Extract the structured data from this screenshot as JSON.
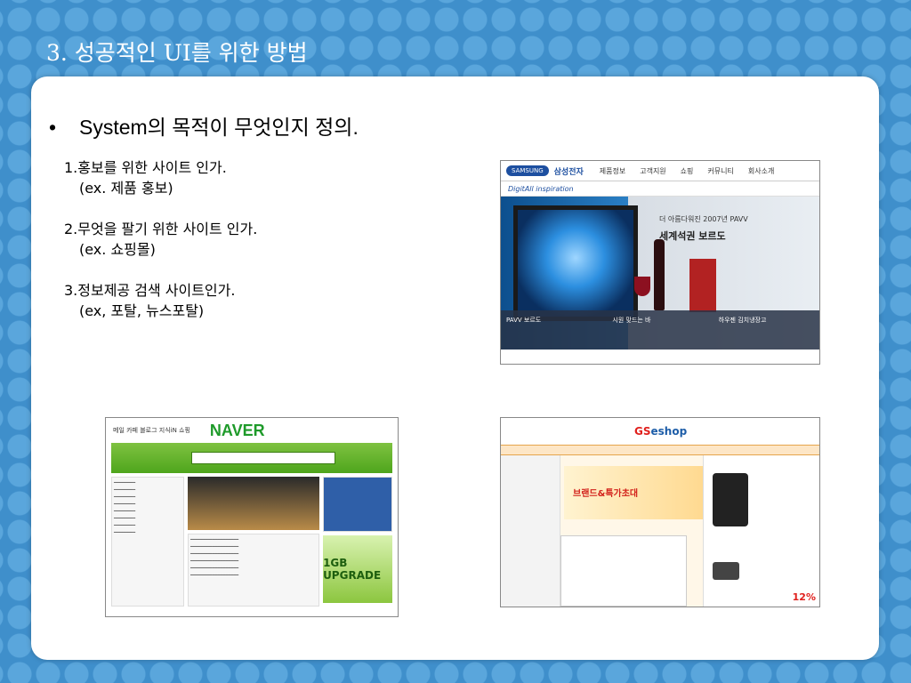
{
  "slide": {
    "title": "3. 성공적인 UI를 위한 방법",
    "bullet": "System의 목적이 무엇인지 정의.",
    "items": [
      {
        "label": "1.홍보를 위한 사이트 인가.",
        "example": "(ex. 제품 홍보)"
      },
      {
        "label": "2.무엇을 팔기 위한 사이트 인가.",
        "example": "(ex. 쇼핑몰)"
      },
      {
        "label": "3.정보제공 검색 사이트인가.",
        "example": "(ex, 포탈, 뉴스포탈)"
      }
    ]
  },
  "screenshots": {
    "samsung": {
      "logo": "SAMSUNG",
      "brand": "삼성전자",
      "nav": [
        "제품정보",
        "고객지원",
        "쇼핑",
        "커뮤니티",
        "회사소개"
      ],
      "tagline": "DigitAll inspiration",
      "ad_line1": "더 아름다워진 2007년 PAVV",
      "ad_line2": "세계석권 보르도",
      "captions": [
        "PAVV 보르도",
        "시원 맞드는 바",
        "하우젠 김치냉장고"
      ]
    },
    "naver": {
      "logo": "NAVER",
      "top_links": "메일 카페 블로그 지식iN 쇼핑",
      "storage_text": "1GB UPGRADE"
    },
    "gs": {
      "logo_gs": "GS",
      "logo_rest": "eshop",
      "banner": "브랜드&특가초대",
      "discount": "12%"
    }
  }
}
